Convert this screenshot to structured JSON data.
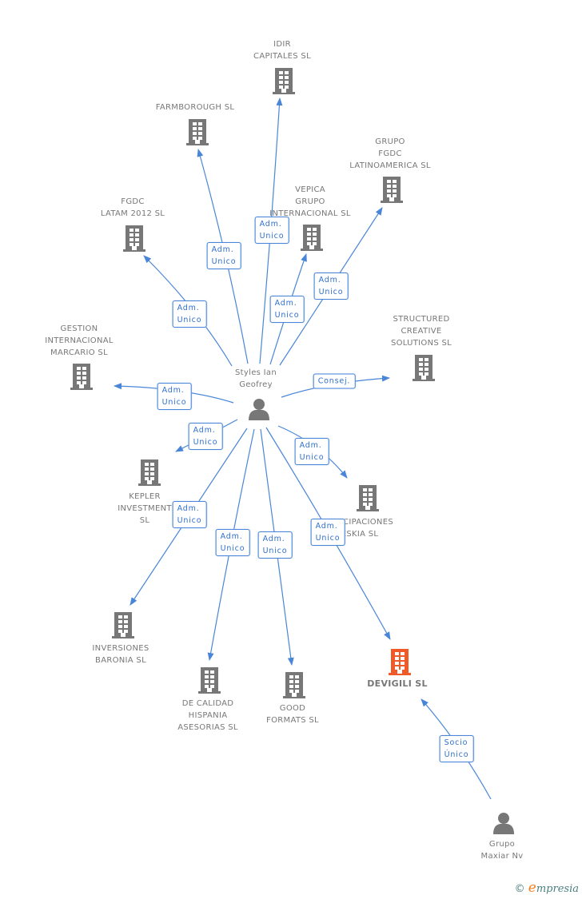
{
  "colors": {
    "edge": "#4a86d8",
    "node": "#777777",
    "focus": "#f05a28"
  },
  "nodes": [
    {
      "id": "center",
      "type": "person",
      "label": [
        "Styles Ian",
        "Geofrey"
      ]
    },
    {
      "id": "idir",
      "type": "company",
      "label": [
        "IDIR",
        "CAPITALES SL"
      ]
    },
    {
      "id": "farm",
      "type": "company",
      "label": [
        "FARMBOROUGH SL"
      ]
    },
    {
      "id": "grupo",
      "type": "company",
      "label": [
        "GRUPO",
        "FGDC",
        "LATINOAMERICA SL"
      ]
    },
    {
      "id": "vepica",
      "type": "company",
      "label": [
        "VEPICA",
        "GRUPO",
        "INTERNACIONAL SL"
      ]
    },
    {
      "id": "fgdc",
      "type": "company",
      "label": [
        "FGDC",
        "LATAM 2012 SL"
      ]
    },
    {
      "id": "structured",
      "type": "company",
      "label": [
        "STRUCTURED",
        "CREATIVE",
        "SOLUTIONS  SL"
      ]
    },
    {
      "id": "gestion",
      "type": "company",
      "label": [
        "GESTION",
        "INTERNACIONAL",
        "MARCARIO  SL"
      ]
    },
    {
      "id": "kepler",
      "type": "company",
      "label": [
        "KEPLER",
        "INVESTMENT",
        "SL"
      ]
    },
    {
      "id": "partic",
      "type": "company",
      "label": [
        "PARTICIPACIONES",
        "DESKIA SL"
      ]
    },
    {
      "id": "inversiones",
      "type": "company",
      "label": [
        "INVERSIONES",
        "BARONIA SL"
      ]
    },
    {
      "id": "calidad",
      "type": "company",
      "label": [
        "DE CALIDAD",
        "HISPANIA",
        "ASESORIAS  SL"
      ]
    },
    {
      "id": "good",
      "type": "company",
      "label": [
        "GOOD",
        "FORMATS SL"
      ]
    },
    {
      "id": "devigili",
      "type": "company",
      "focus": true,
      "label": [
        "DEVIGILI SL"
      ]
    },
    {
      "id": "maxiar",
      "type": "person",
      "label": [
        "Grupo",
        "Maxiar Nv"
      ]
    }
  ],
  "edges": [
    {
      "to": "idir",
      "label": [
        "Adm.",
        "Unico"
      ]
    },
    {
      "to": "farm",
      "label": [
        "Adm.",
        "Unico"
      ]
    },
    {
      "to": "grupo",
      "label": [
        "Adm.",
        "Unico"
      ]
    },
    {
      "to": "vepica",
      "label": [
        "Adm.",
        "Unico"
      ]
    },
    {
      "to": "fgdc",
      "label": [
        "Adm.",
        "Unico"
      ]
    },
    {
      "to": "structured",
      "label": [
        "Consej."
      ]
    },
    {
      "to": "gestion",
      "label": [
        "Adm.",
        "Unico"
      ]
    },
    {
      "to": "kepler",
      "label": [
        "Adm.",
        "Unico"
      ]
    },
    {
      "to": "partic",
      "label": [
        "Adm.",
        "Unico"
      ]
    },
    {
      "to": "inversiones",
      "label": [
        "Adm.",
        "Unico"
      ]
    },
    {
      "to": "calidad",
      "label": [
        "Adm.",
        "Unico"
      ]
    },
    {
      "to": "good",
      "label": [
        "Adm.",
        "Unico"
      ]
    },
    {
      "to": "devigili",
      "label": [
        "Adm.",
        "Unico"
      ]
    },
    {
      "from": "maxiar",
      "to": "devigili",
      "label": [
        "Socio",
        "Único"
      ]
    }
  ],
  "footer": {
    "copyright": "©",
    "brand_e": "e",
    "brand_rest": "mpresia"
  }
}
